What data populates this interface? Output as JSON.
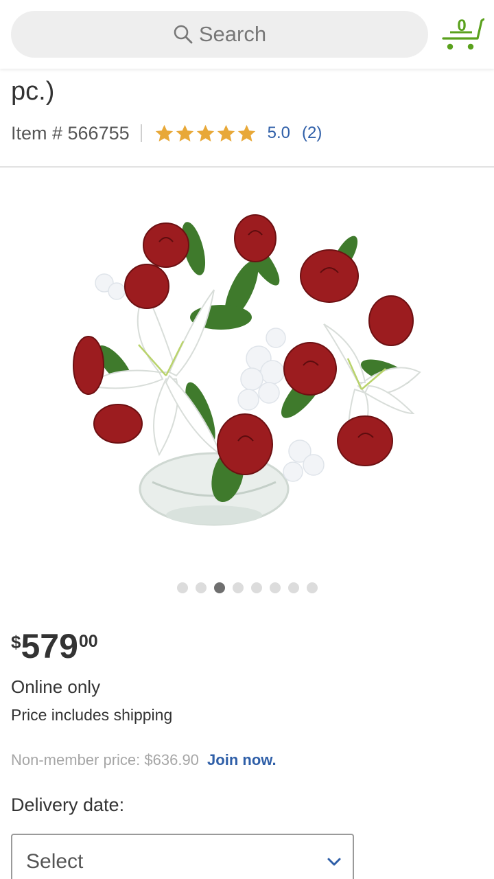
{
  "header": {
    "search_placeholder": "Search",
    "cart_count": "0",
    "colors": {
      "accent": "#5aa11d",
      "search_bg": "#eeeeee"
    }
  },
  "product": {
    "title_fragment": "pc.)",
    "item_number": "Item # 566755",
    "rating_value": "5.0",
    "review_count": "(2)",
    "stars": 5,
    "image_icon": "flower-bouquet-image",
    "carousel": {
      "total": 8,
      "active_index": 2
    }
  },
  "pricing": {
    "currency": "$",
    "dollars": "579",
    "cents": "00",
    "availability": "Online only",
    "shipping_note": "Price includes shipping",
    "nonmember_text": "Non-member price: $636.90",
    "join_link": "Join now."
  },
  "delivery": {
    "label": "Delivery date:",
    "selected": "Select"
  }
}
